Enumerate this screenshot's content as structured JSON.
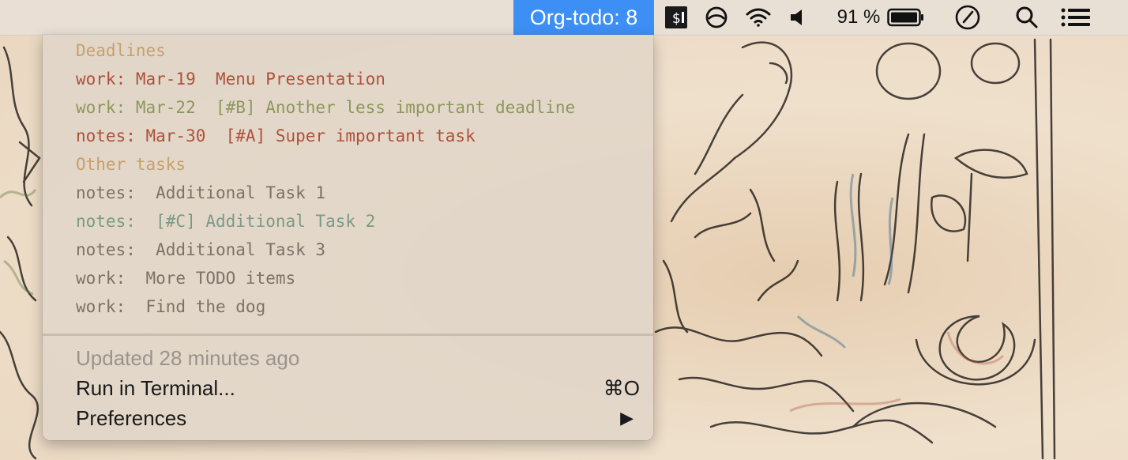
{
  "menubar": {
    "org_todo_label": "Org-todo: 8",
    "battery_percent": "91 %",
    "battery_level": 0.91,
    "icons": {
      "terminal": "terminal-icon",
      "circle": "creative-cloud-icon",
      "wifi": "wifi-icon",
      "volume": "volume-icon",
      "battery": "battery-icon",
      "clock": "clock-icon",
      "search": "search-icon",
      "list": "notification-center-icon"
    },
    "accent_color": "#3d8ff5"
  },
  "dropdown": {
    "todos": [
      {
        "text": "Deadlines",
        "style": "heading"
      },
      {
        "text": "work: Mar-19  Menu Presentation",
        "style": "urgent"
      },
      {
        "text": "work: Mar-22  [#B] Another less important deadline",
        "style": "olive"
      },
      {
        "text": "notes: Mar-30  [#A] Super important task",
        "style": "urgent"
      },
      {
        "text": "Other tasks",
        "style": "heading"
      },
      {
        "text": "notes:  Additional Task 1",
        "style": "plain"
      },
      {
        "text": "notes:  [#C] Additional Task 2",
        "style": "teal"
      },
      {
        "text": "notes:  Additional Task 3",
        "style": "plain"
      },
      {
        "text": "work:  More TODO items",
        "style": "plain"
      },
      {
        "text": "work:  Find the dog",
        "style": "plain"
      }
    ],
    "status": "Updated 28 minutes ago",
    "run_in_terminal": {
      "label": "Run in Terminal...",
      "shortcut": "⌘O"
    },
    "preferences": {
      "label": "Preferences",
      "arrow": "▶"
    },
    "colors": {
      "heading": "#c7a06c",
      "urgent": "#b0503a",
      "olive": "#8c985c",
      "teal": "#7a9a86",
      "plain": "#7c7268"
    }
  }
}
